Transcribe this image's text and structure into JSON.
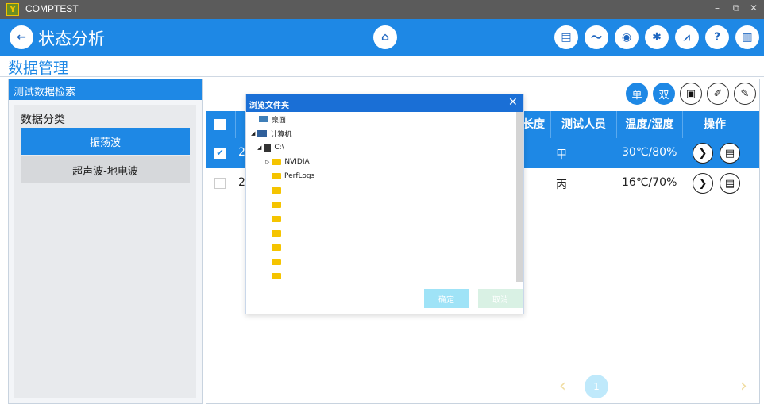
{
  "window": {
    "app_name": "COMPTEST",
    "logo_text": "Y",
    "minimize": "–",
    "restore": "⧉",
    "close": "✕"
  },
  "header": {
    "page_title": "状态分析",
    "back_icon": "←",
    "home_icon": "⌂",
    "tools": [
      "clipboard-icon",
      "trend-icon",
      "camera-icon",
      "settings-icon",
      "chart-icon",
      "help-icon",
      "book-icon"
    ],
    "tool_glyphs": [
      "▤",
      "〜",
      "◉",
      "✱",
      "⩘",
      "?",
      "▥"
    ]
  },
  "section": {
    "title": "数据管理"
  },
  "left": {
    "header": "测试数据检索",
    "category_title": "数据分类",
    "categories": [
      {
        "label": "振荡波",
        "active": true
      },
      {
        "label": "超声波-地电波",
        "active": false
      }
    ]
  },
  "right": {
    "toolbar": {
      "single": "单",
      "double": "双",
      "save_glyph": "▣",
      "wand_glyph": "✐",
      "edit_glyph": "✎"
    },
    "columns": [
      "长度",
      "测试人员",
      "温度/湿度",
      "操作"
    ],
    "rows": [
      {
        "id_prefix": "2(",
        "person": "甲",
        "temp_humidity": "30℃/80%",
        "checked": true
      },
      {
        "id_prefix": "2(",
        "person": "丙",
        "temp_humidity": "16℃/70%",
        "checked": false
      }
    ],
    "row_action_glyphs": [
      "❯",
      "▤"
    ]
  },
  "dialog": {
    "title": "浏览文件夹",
    "close": "✕",
    "tree": [
      {
        "label": "桌面",
        "level": 0,
        "icon": "desktop-icon"
      },
      {
        "label": "计算机",
        "level": 0,
        "icon": "computer-icon",
        "arrow": "◢"
      },
      {
        "label": "C:\\",
        "level": 1,
        "icon": "drive-icon",
        "arrow": "◢"
      },
      {
        "label": "NVIDIA",
        "level": 2,
        "icon": "folder-icon",
        "arrow": "▷"
      },
      {
        "label": "PerfLogs",
        "level": 2,
        "icon": "folder-icon"
      },
      {
        "label": "",
        "level": 2,
        "icon": "folder-icon"
      },
      {
        "label": "",
        "level": 2,
        "icon": "folder-icon"
      },
      {
        "label": "",
        "level": 2,
        "icon": "folder-icon"
      },
      {
        "label": "",
        "level": 2,
        "icon": "folder-icon"
      },
      {
        "label": "",
        "level": 2,
        "icon": "folder-icon"
      },
      {
        "label": "",
        "level": 2,
        "icon": "folder-icon"
      },
      {
        "label": "",
        "level": 2,
        "icon": "folder-icon"
      }
    ],
    "ok_label": "确定",
    "cancel_label": "取消"
  },
  "pager": {
    "prev": "‹",
    "page": "1",
    "next": "›"
  },
  "colors": {
    "accent": "#1e88e5",
    "titlebar": "#5b5b5b",
    "dialog_head": "#1a6fd6",
    "ok_button": "#9fe3f7",
    "cancel_button": "#d9f1e4"
  }
}
